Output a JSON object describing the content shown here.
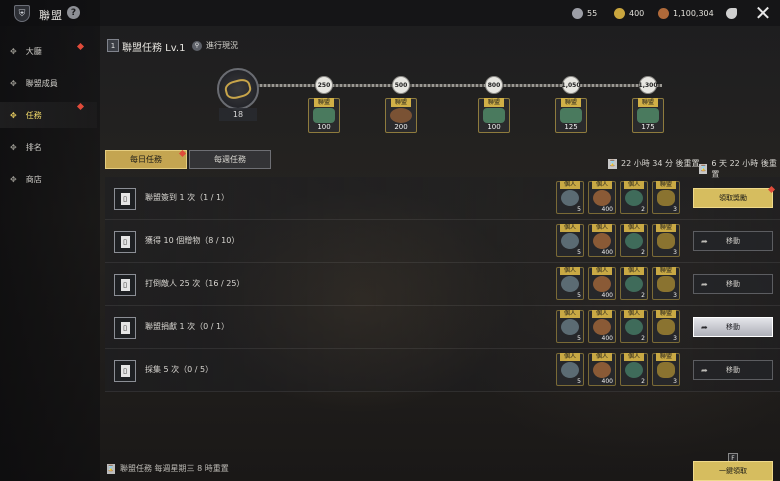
{
  "header": {
    "title": "聯盟"
  },
  "currencies": [
    {
      "name": "silver-coin-icon",
      "value": "55",
      "color": "#9c9ea6"
    },
    {
      "name": "gold-coin-icon",
      "value": "400",
      "color": "#c9a53e"
    },
    {
      "name": "copper-coin-icon",
      "value": "1,100,304",
      "color": "#b06a3a"
    },
    {
      "name": "toggle-icon",
      "value": "",
      "color": "#d0d0d0"
    }
  ],
  "sidebar": {
    "items": [
      {
        "label": "大廳",
        "active": false,
        "dot": true
      },
      {
        "label": "聯盟成員",
        "active": false,
        "dot": false
      },
      {
        "label": "任務",
        "active": true,
        "dot": true
      },
      {
        "label": "排名",
        "active": false,
        "dot": false
      },
      {
        "label": "商店",
        "active": false,
        "dot": false
      }
    ]
  },
  "mission": {
    "badge": "1",
    "title": "聯盟任務 Lv.1",
    "progress_link": "進行現況",
    "current_score": "18",
    "milestones": [
      {
        "value": "250",
        "reward_tag": "聯盟",
        "reward_count": "100",
        "reward_type": "exp"
      },
      {
        "value": "500",
        "reward_tag": "聯盟",
        "reward_count": "200",
        "reward_type": "bag"
      },
      {
        "value": "800",
        "reward_tag": "聯盟",
        "reward_count": "100",
        "reward_type": "exp"
      },
      {
        "value": "1,050",
        "reward_tag": "聯盟",
        "reward_count": "125",
        "reward_type": "exp"
      },
      {
        "value": "1,300",
        "reward_tag": "聯盟",
        "reward_count": "175",
        "reward_type": "exp"
      }
    ]
  },
  "tabs": [
    {
      "label": "每日任務",
      "active": true
    },
    {
      "label": "每週任務",
      "active": false
    }
  ],
  "timers": {
    "daily": "22 小時 34 分 後重置",
    "weekly": "6 天 22 小時 後重置"
  },
  "tasks": [
    {
      "name": "聯盟簽到 1 次（1 / 1）",
      "rewards": [
        "5",
        "400",
        "2",
        "3"
      ],
      "action": "領取獎勵",
      "state": "claim"
    },
    {
      "name": "獲得 10 個贈物（8 / 10）",
      "rewards": [
        "5",
        "400",
        "2",
        "3"
      ],
      "action": "移動",
      "state": "move"
    },
    {
      "name": "打倒敵人 25 次（16 / 25）",
      "rewards": [
        "5",
        "400",
        "2",
        "3"
      ],
      "action": "移動",
      "state": "move"
    },
    {
      "name": "聯盟捐獻 1 次（0 / 1）",
      "rewards": [
        "5",
        "400",
        "2",
        "3"
      ],
      "action": "移動",
      "state": "highlight"
    },
    {
      "name": "採集 5 次（0 / 5）",
      "rewards": [
        "5",
        "400",
        "2",
        "3"
      ],
      "action": "移動",
      "state": "move"
    }
  ],
  "reward_tags": [
    "個人",
    "個人",
    "個人",
    "聯盟"
  ],
  "footer": {
    "note": "聯盟任務  每週星期三 8 時重置",
    "claim_all": "一鍵領取",
    "key_hint": "F"
  }
}
